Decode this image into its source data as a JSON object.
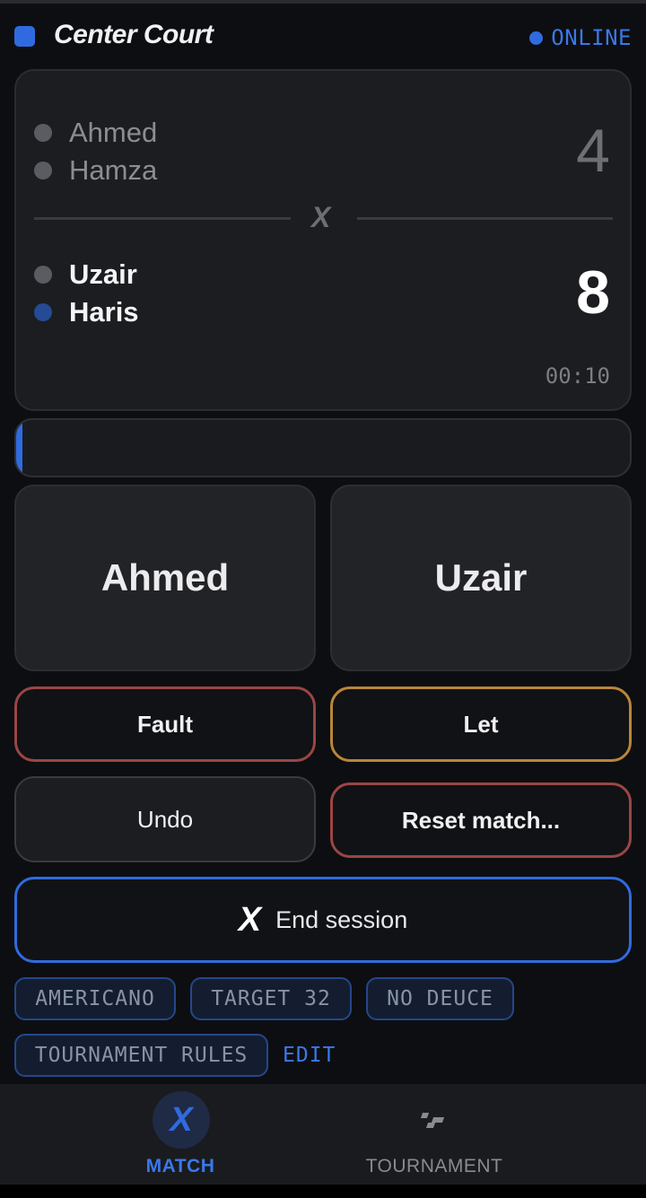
{
  "header": {
    "title": "Center Court",
    "status": "ONLINE",
    "accent_color": "#2f6bdf"
  },
  "scoreboard": {
    "team1": {
      "players": [
        "Ahmed",
        "Hamza"
      ],
      "score": "4"
    },
    "team2": {
      "players": [
        "Uzair",
        "Haris"
      ],
      "score": "8"
    },
    "vs_symbol": "X",
    "timer": "00:10"
  },
  "progress": {
    "fraction": 0.01
  },
  "actions": {
    "point_left": "Ahmed",
    "point_right": "Uzair",
    "fault": "Fault",
    "let": "Let",
    "undo": "Undo",
    "reset": "Reset match...",
    "end_session": "End session",
    "end_session_icon": "x-logo-icon"
  },
  "rules": {
    "chips": [
      "AMERICANO",
      "TARGET 32",
      "NO DEUCE",
      "TOURNAMENT RULES"
    ],
    "edit_label": "EDIT"
  },
  "nav": {
    "items": [
      {
        "label": "MATCH",
        "icon": "x-logo-icon",
        "active": true
      },
      {
        "label": "TOURNAMENT",
        "icon": "bracket-icon",
        "active": false
      }
    ]
  }
}
